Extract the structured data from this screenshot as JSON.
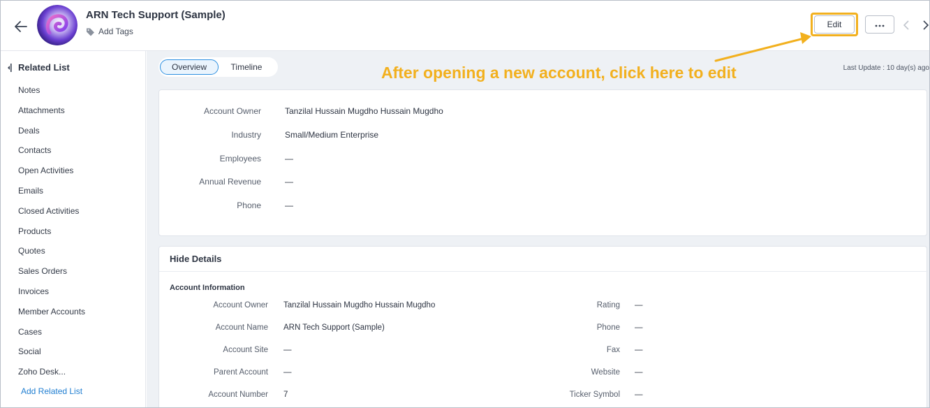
{
  "header": {
    "title": "ARN Tech Support (Sample)",
    "add_tags": "Add Tags",
    "edit": "Edit"
  },
  "annotation": {
    "text": "After opening a new account, click here to edit",
    "color": "#f2b01e"
  },
  "sidebar": {
    "heading": "Related List",
    "items": [
      "Notes",
      "Attachments",
      "Deals",
      "Contacts",
      "Open Activities",
      "Emails",
      "Closed Activities",
      "Products",
      "Quotes",
      "Sales Orders",
      "Invoices",
      "Member Accounts",
      "Cases",
      "Social",
      "Zoho Desk..."
    ],
    "add_related": "Add Related List"
  },
  "tabs": {
    "overview": "Overview",
    "timeline": "Timeline"
  },
  "last_update": "Last Update : 10 day(s) ago",
  "overview": [
    {
      "label": "Account Owner",
      "value": "Tanzilal Hussain Mugdho Hussain Mugdho"
    },
    {
      "label": "Industry",
      "value": "Small/Medium Enterprise"
    },
    {
      "label": "Employees",
      "value": "—"
    },
    {
      "label": "Annual Revenue",
      "value": "—"
    },
    {
      "label": "Phone",
      "value": "—"
    }
  ],
  "details": {
    "toggle": "Hide Details",
    "section": "Account Information",
    "left": [
      {
        "label": "Account Owner",
        "value": "Tanzilal Hussain Mugdho Hussain Mugdho"
      },
      {
        "label": "Account Name",
        "value": "ARN Tech Support (Sample)"
      },
      {
        "label": "Account Site",
        "value": "—"
      },
      {
        "label": "Parent Account",
        "value": "—"
      },
      {
        "label": "Account Number",
        "value": "7"
      }
    ],
    "right": [
      {
        "label": "Rating",
        "value": "—"
      },
      {
        "label": "Phone",
        "value": "—"
      },
      {
        "label": "Fax",
        "value": "—"
      },
      {
        "label": "Website",
        "value": "—"
      },
      {
        "label": "Ticker Symbol",
        "value": "—"
      }
    ]
  },
  "colors": {
    "accent": "#2b8ee0",
    "highlight": "#f2b01e",
    "link": "#1f7ed1"
  }
}
